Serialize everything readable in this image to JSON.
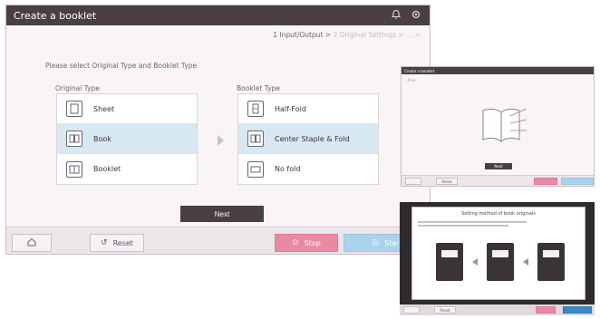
{
  "main": {
    "title": "Create a booklet",
    "crumb": {
      "current": "1 Input/Output >",
      "rest": "2 Original Settings > ... >"
    },
    "instruction": "Please select Original Type and Booklet Type",
    "original_label": "Original Type",
    "booklet_label": "Booklet Type",
    "original_options": [
      {
        "label": "Sheet",
        "icon": "sheet-icon"
      },
      {
        "label": "Book",
        "icon": "book-icon"
      },
      {
        "label": "Booklet",
        "icon": "booklet-icon"
      }
    ],
    "booklet_options": [
      {
        "label": "Half-Fold",
        "icon": "half-fold-icon"
      },
      {
        "label": "Center Staple & Fold",
        "icon": "center-staple-fold-icon"
      },
      {
        "label": "No fold",
        "icon": "no-fold-icon"
      }
    ],
    "next_label": "Next",
    "bottom": {
      "reset_label": "Reset",
      "stop_label": "Stop",
      "start_label": "Start"
    }
  },
  "thumb1": {
    "title": "Create a booklet",
    "next_label": "Next",
    "reset_label": "Reset"
  },
  "thumb2": {
    "title": "Setting method of book originals",
    "reset_label": "Reset"
  },
  "colors": {
    "titlebar": "#4a3f44",
    "selected": "#d8e8f2",
    "stop": "#e98aa2",
    "start": "#a9d3ec",
    "panel": "#f9f4f6"
  }
}
